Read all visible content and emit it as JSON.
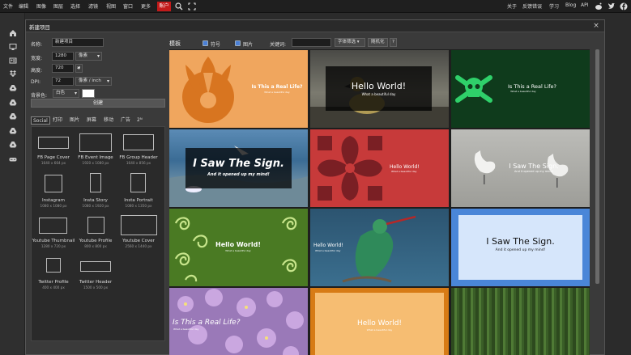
{
  "menubar": {
    "items": [
      "文件",
      "编辑",
      "图像",
      "图层",
      "选择",
      "滤镜",
      "视图",
      "窗口",
      "更多"
    ],
    "account": "账户",
    "right_items": [
      "关于",
      "反馈错误",
      "学习",
      "Blog",
      "API"
    ]
  },
  "dialog": {
    "title": "新建项目",
    "fields": {
      "name_label": "名称:",
      "name_value": "新建项目",
      "width_label": "宽度:",
      "width_value": "1280",
      "width_unit": "像素",
      "height_label": "高度:",
      "height_value": "720",
      "dpi_label": "DPI:",
      "dpi_value": "72",
      "dpi_unit": "像素 / inch",
      "bg_label": "背景色:",
      "bg_value": "白色"
    },
    "create_button": "创建",
    "tabs": [
      "Social",
      "打印",
      "图片",
      "屏幕",
      "移动",
      "广告",
      "2ᴺ"
    ],
    "presets": [
      {
        "name": "FB Page Cover",
        "size": "1640 x 664 px"
      },
      {
        "name": "FB Event Image",
        "size": "1920 x 1080 px"
      },
      {
        "name": "FB Group Header",
        "size": "1640 x 856 px"
      },
      {
        "name": "Instagram",
        "size": "1080 x 1080 px"
      },
      {
        "name": "Insta Story",
        "size": "1080 x 1920 px"
      },
      {
        "name": "Insta Portrait",
        "size": "1080 x 1350 px"
      },
      {
        "name": "Youtube Thumbnail",
        "size": "1280 x 720 px"
      },
      {
        "name": "Youtube Profile",
        "size": "800 x 800 px"
      },
      {
        "name": "Youtube Cover",
        "size": "2560 x 1440 px"
      },
      {
        "name": "Twitter Profile",
        "size": "400 x 400 px"
      },
      {
        "name": "Twitter Header",
        "size": "1500 x 500 px"
      }
    ],
    "templates": {
      "label": "模板",
      "checkbox_symbols": "符号",
      "checkbox_images": "图片",
      "keyword_label": "关键词:",
      "font_filter": "字体筛选",
      "random_button": "随机化",
      "help": "?"
    },
    "tiles": [
      {
        "title": "Is This a Real Life?",
        "sub": "What a beautiful day"
      },
      {
        "title": "Hello World!",
        "sub": "What a beautiful day"
      },
      {
        "title": "Is This a Real Life?",
        "sub": "What a beautiful day"
      },
      {
        "title": "I Saw The Sign.",
        "sub": "And it opened up my mind!"
      },
      {
        "title": "Hello World!",
        "sub": "What a beautiful day"
      },
      {
        "title": "I Saw The Sign.",
        "sub": "And it opened up my mind!"
      },
      {
        "title": "Hello World!",
        "sub": "What a beautiful day"
      },
      {
        "title": "Hello World!",
        "sub": "What a beautiful day"
      },
      {
        "title": "I Saw The Sign.",
        "sub": "And it opened up my mind!"
      },
      {
        "title": "Is This a Real Life?",
        "sub": "What a beautiful day"
      },
      {
        "title": "Hello World!",
        "sub": "What a beautiful day"
      },
      {
        "title": "",
        "sub": ""
      }
    ]
  },
  "colors": {
    "accent": "#c21a1a",
    "checkbox": "#4a7fd6"
  }
}
